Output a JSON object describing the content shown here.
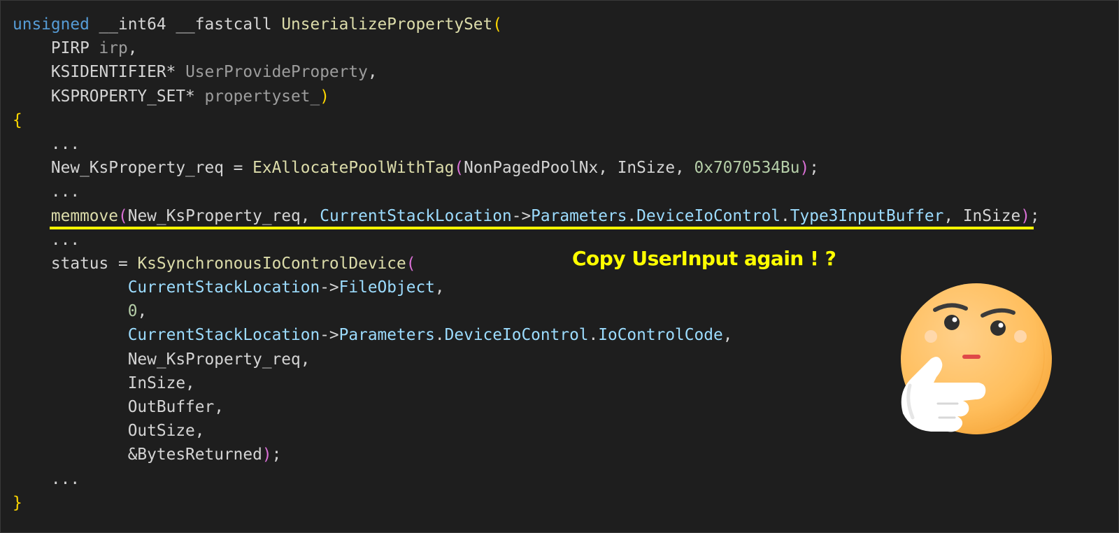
{
  "colors": {
    "background": "#1e1e1e",
    "keyword": "#569cd6",
    "function": "#dcdcaa",
    "parameter": "#9d9d9d",
    "plain": "#d4d4d4",
    "variable": "#9cdcfe",
    "number": "#b5cea8",
    "bracket_level1": "#ffd700",
    "bracket_level2": "#da70d6",
    "highlight": "#ffff00"
  },
  "code_lines": [
    [
      {
        "t": "unsigned",
        "c": "kw"
      },
      {
        "t": " __int64 __fastcall ",
        "c": "plain"
      },
      {
        "t": "UnserializePropertySet",
        "c": "fn"
      },
      {
        "t": "(",
        "c": "p1"
      }
    ],
    [
      {
        "t": "    PIRP ",
        "c": "plain"
      },
      {
        "t": "irp",
        "c": "param"
      },
      {
        "t": ",",
        "c": "plain"
      }
    ],
    [
      {
        "t": "    KSIDENTIFIER* ",
        "c": "plain"
      },
      {
        "t": "UserProvideProperty",
        "c": "param"
      },
      {
        "t": ",",
        "c": "plain"
      }
    ],
    [
      {
        "t": "    KSPROPERTY_SET* ",
        "c": "plain"
      },
      {
        "t": "propertyset_",
        "c": "param"
      },
      {
        "t": ")",
        "c": "p1"
      }
    ],
    [
      {
        "t": "{",
        "c": "p1"
      }
    ],
    [
      {
        "t": "    ...",
        "c": "plain"
      }
    ],
    [
      {
        "t": "    New_KsProperty_req = ",
        "c": "plain"
      },
      {
        "t": "ExAllocatePoolWithTag",
        "c": "fn"
      },
      {
        "t": "(",
        "c": "p2"
      },
      {
        "t": "NonPagedPoolNx, InSize, ",
        "c": "plain"
      },
      {
        "t": "0x7070534Bu",
        "c": "num"
      },
      {
        "t": ")",
        "c": "p2"
      },
      {
        "t": ";",
        "c": "plain"
      }
    ],
    [
      {
        "t": "    ...",
        "c": "plain"
      }
    ],
    [
      {
        "t": "    ",
        "c": "plain"
      },
      {
        "t": "memmove",
        "c": "fn"
      },
      {
        "t": "(",
        "c": "p2"
      },
      {
        "t": "New_KsProperty_req, ",
        "c": "plain"
      },
      {
        "t": "CurrentStackLocation",
        "c": "var"
      },
      {
        "t": "->",
        "c": "plain"
      },
      {
        "t": "Parameters",
        "c": "var"
      },
      {
        "t": ".",
        "c": "plain"
      },
      {
        "t": "DeviceIoControl",
        "c": "var"
      },
      {
        "t": ".",
        "c": "plain"
      },
      {
        "t": "Type3InputBuffer",
        "c": "var"
      },
      {
        "t": ", InSize",
        "c": "plain"
      },
      {
        "t": ")",
        "c": "p2"
      },
      {
        "t": ";",
        "c": "plain"
      }
    ],
    [
      {
        "t": "    ...",
        "c": "plain"
      }
    ],
    [
      {
        "t": "    status = ",
        "c": "plain"
      },
      {
        "t": "KsSynchronousIoControlDevice",
        "c": "fn"
      },
      {
        "t": "(",
        "c": "p2"
      }
    ],
    [
      {
        "t": "            ",
        "c": "plain"
      },
      {
        "t": "CurrentStackLocation",
        "c": "var"
      },
      {
        "t": "->",
        "c": "plain"
      },
      {
        "t": "FileObject",
        "c": "var"
      },
      {
        "t": ",",
        "c": "plain"
      }
    ],
    [
      {
        "t": "            ",
        "c": "plain"
      },
      {
        "t": "0",
        "c": "num"
      },
      {
        "t": ",",
        "c": "plain"
      }
    ],
    [
      {
        "t": "            ",
        "c": "plain"
      },
      {
        "t": "CurrentStackLocation",
        "c": "var"
      },
      {
        "t": "->",
        "c": "plain"
      },
      {
        "t": "Parameters",
        "c": "var"
      },
      {
        "t": ".",
        "c": "plain"
      },
      {
        "t": "DeviceIoControl",
        "c": "var"
      },
      {
        "t": ".",
        "c": "plain"
      },
      {
        "t": "IoControlCode",
        "c": "var"
      },
      {
        "t": ",",
        "c": "plain"
      }
    ],
    [
      {
        "t": "            New_KsProperty_req,",
        "c": "plain"
      }
    ],
    [
      {
        "t": "            InSize,",
        "c": "plain"
      }
    ],
    [
      {
        "t": "            OutBuffer,",
        "c": "plain"
      }
    ],
    [
      {
        "t": "            OutSize,",
        "c": "plain"
      }
    ],
    [
      {
        "t": "            &BytesReturned",
        "c": "plain"
      },
      {
        "t": ")",
        "c": "p2"
      },
      {
        "t": ";",
        "c": "plain"
      }
    ],
    [
      {
        "t": "    ...",
        "c": "plain"
      }
    ],
    [
      {
        "t": "}",
        "c": "p1"
      }
    ]
  ],
  "annotation": {
    "text": "Copy UserInput again ! ?",
    "highlighted_line": 8
  },
  "icons": {
    "emoji": "thinking-face-icon"
  }
}
